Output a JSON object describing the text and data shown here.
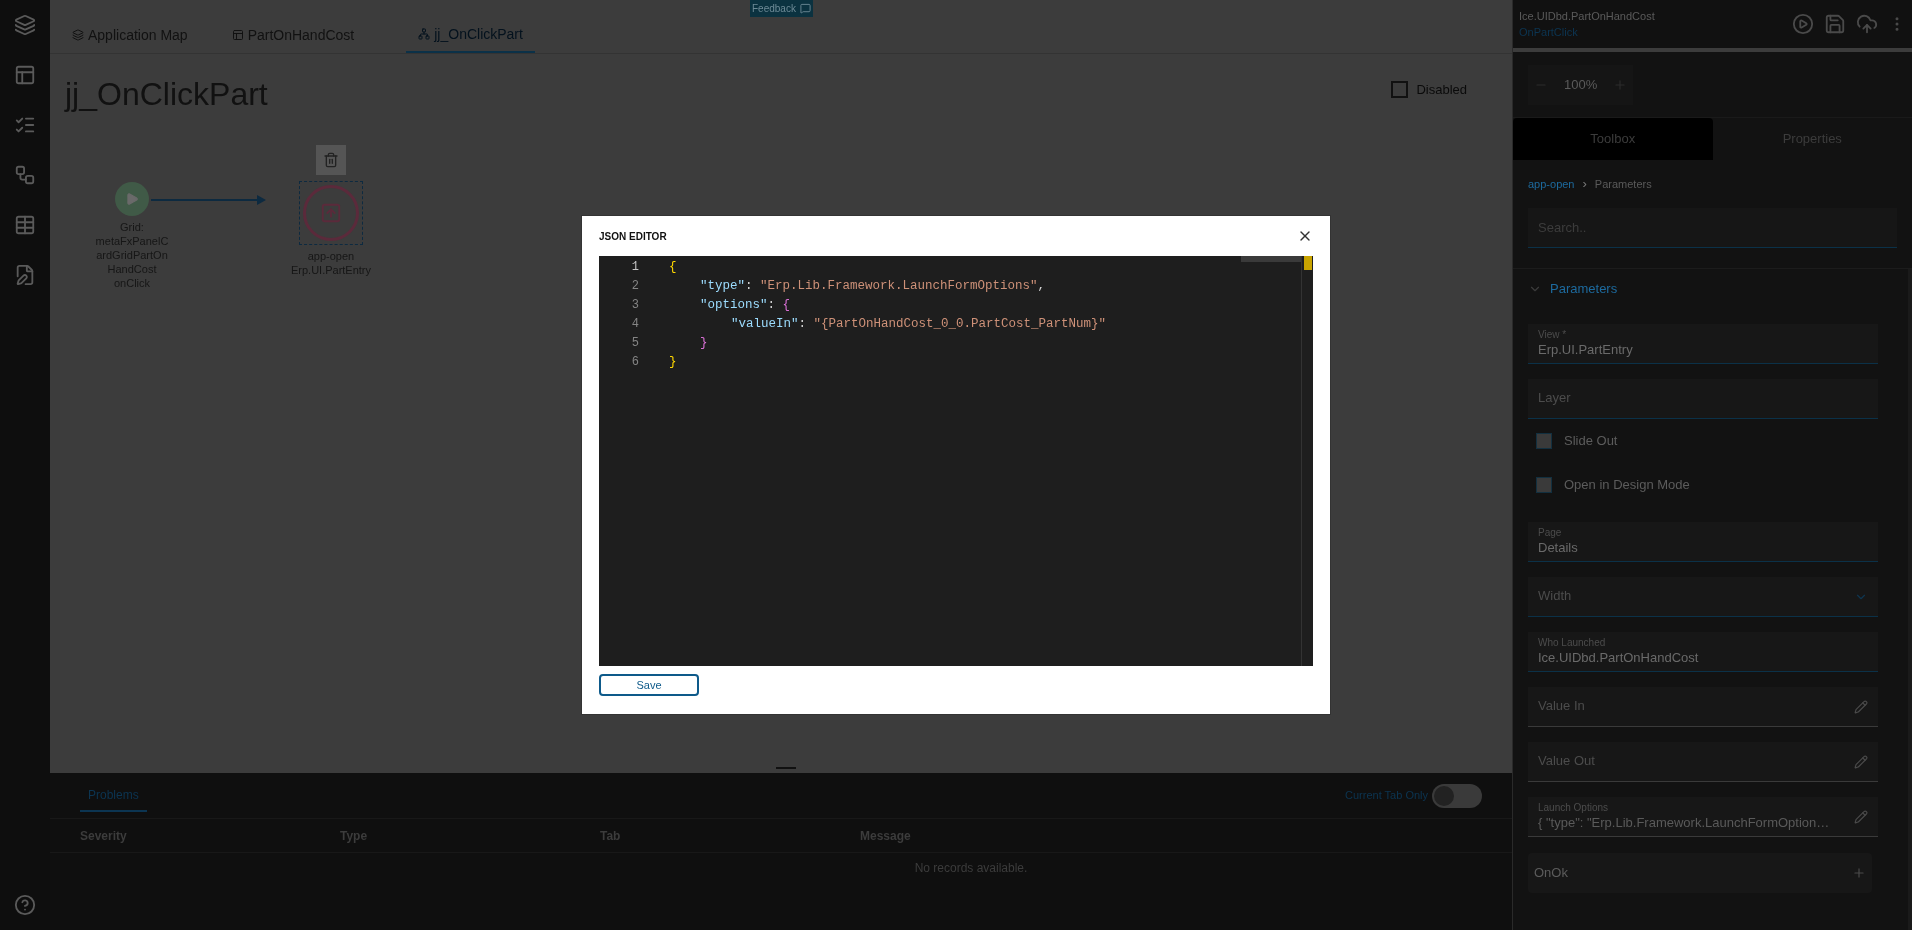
{
  "feedback": {
    "label": "Feedback"
  },
  "tabs": [
    {
      "label": "Application Map",
      "selected": false
    },
    {
      "label": "PartOnHandCost",
      "selected": false
    },
    {
      "label": "jj_OnClickPart",
      "selected": true
    }
  ],
  "page_title": "jj_OnClickPart",
  "disabled": {
    "label": "Disabled",
    "checked": false
  },
  "diagram": {
    "nodes": [
      {
        "kind": "start",
        "lines": [
          "Grid:",
          "metaFxPanelC",
          "ardGridPartOn",
          "HandCost",
          "onClick"
        ],
        "selected": false
      },
      {
        "kind": "action",
        "lines": [
          "app-open",
          "Erp.UI.PartEntry"
        ],
        "selected": true
      }
    ]
  },
  "problems": {
    "tab": "Problems",
    "toggle": {
      "label": "Current Tab Only",
      "on": false
    },
    "columns": [
      "Severity",
      "Type",
      "Tab",
      "Message"
    ],
    "empty": "No records available."
  },
  "header": {
    "title": "Ice.UIDbd.PartOnHandCost",
    "subtitle": "OnPartClick"
  },
  "zoom": {
    "value": "100%"
  },
  "panel_tabs": [
    {
      "label": "Toolbox",
      "selected": true
    },
    {
      "label": "Properties",
      "selected": false
    }
  ],
  "breadcrumb": [
    "app-open",
    "›",
    "Parameters"
  ],
  "search": {
    "placeholder": "Search.."
  },
  "section": {
    "label": "Parameters",
    "expanded": true
  },
  "fields": [
    {
      "kind": "text",
      "label": "View *",
      "value": "Erp.UI.PartEntry"
    },
    {
      "kind": "text",
      "label": "Layer"
    },
    {
      "kind": "checkbox",
      "label": "Slide Out",
      "checked": false
    },
    {
      "kind": "checkbox",
      "label": "Open in Design Mode",
      "checked": false
    },
    {
      "kind": "text",
      "label": "Page",
      "value": "Details"
    },
    {
      "kind": "select",
      "label": "Width"
    },
    {
      "kind": "text",
      "label": "Who Launched",
      "value": "Ice.UIDbd.PartOnHandCost"
    },
    {
      "kind": "edit",
      "label": "Value In"
    },
    {
      "kind": "edit",
      "label": "Value Out"
    },
    {
      "kind": "edit",
      "label": "Launch Options",
      "value": "{ \"type\": \"Erp.Lib.Framework.LaunchFormOption…"
    },
    {
      "kind": "event",
      "label": "OnOk"
    }
  ],
  "modal": {
    "title": "JSON EDITOR",
    "save": "Save",
    "lines": [
      {
        "number": "1",
        "current": true,
        "tokens": [
          {
            "kind": "brace1",
            "text": "{"
          }
        ],
        "children": [
          {
            "number": "2",
            "current": false,
            "tokens": [
              {
                "kind": "key",
                "text": "\"type\""
              },
              {
                "kind": "punct",
                "text": ": "
              },
              {
                "kind": "string",
                "text": "\"Erp.Lib.Framework.LaunchFormOptions\""
              },
              {
                "kind": "punct",
                "text": ","
              }
            ]
          },
          {
            "number": "3",
            "current": false,
            "tokens": [
              {
                "kind": "key",
                "text": "\"options\""
              },
              {
                "kind": "punct",
                "text": ": "
              },
              {
                "kind": "brace2",
                "text": "{"
              }
            ],
            "children": [
              {
                "number": "4",
                "current": false,
                "tokens": [
                  {
                    "kind": "key",
                    "text": "\"valueIn\""
                  },
                  {
                    "kind": "punct",
                    "text": ": "
                  },
                  {
                    "kind": "string",
                    "text": "\"{PartOnHandCost_0_0.PartCost_PartNum}\""
                  }
                ]
              }
            ]
          },
          {
            "number": "5",
            "current": false,
            "tokens": [
              {
                "kind": "brace2",
                "text": "}"
              }
            ]
          }
        ]
      },
      {
        "number": "6",
        "current": false,
        "tokens": [
          {
            "kind": "brace1",
            "text": "}"
          }
        ]
      }
    ]
  }
}
